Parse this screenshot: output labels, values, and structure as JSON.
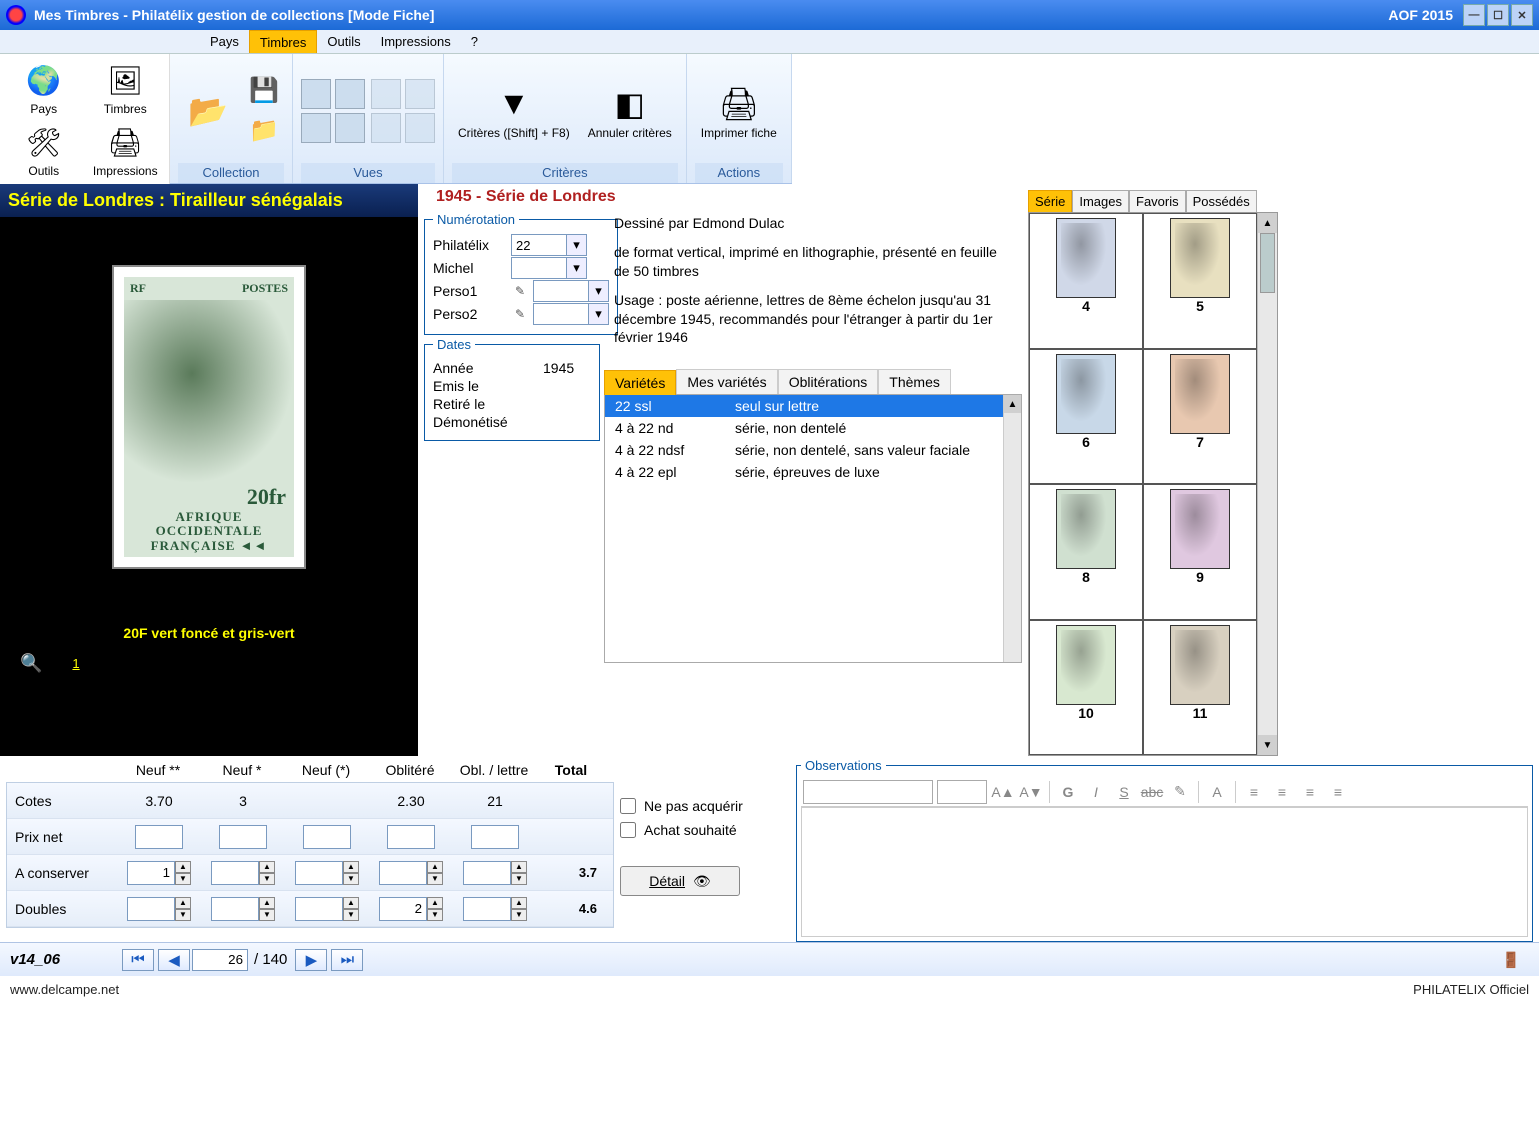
{
  "titlebar": {
    "title": "Mes Timbres - Philatélix gestion de collections [Mode Fiche]",
    "right": "AOF 2015"
  },
  "menustrip": {
    "items": [
      {
        "label": "Pays",
        "active": false
      },
      {
        "label": "Timbres",
        "active": true
      },
      {
        "label": "Outils",
        "active": false
      },
      {
        "label": "Impressions",
        "active": false
      },
      {
        "label": "?",
        "active": false
      }
    ]
  },
  "left_toolbar": [
    {
      "label": "Pays",
      "icon": "🌍"
    },
    {
      "label": "Timbres",
      "icon": "🖼"
    },
    {
      "label": "Outils",
      "icon": "🛠"
    },
    {
      "label": "Impressions",
      "icon": "🖨"
    }
  ],
  "ribbon": {
    "collection": {
      "label": "Collection"
    },
    "vues": {
      "label": "Vues"
    },
    "criteres": {
      "label": "Critères",
      "btn1": "Critères ([Shift] + F8)",
      "btn2": "Annuler critères"
    },
    "actions": {
      "label": "Actions",
      "btn1": "Imprimer fiche"
    }
  },
  "stamp": {
    "panel_title": "Série de Londres : Tirailleur sénégalais",
    "top_left": "RF",
    "top_right": "POSTES",
    "denom": "20fr",
    "country": "AFRIQUE OCCIDENTALE FRANÇAISE ◄◄",
    "caption": "20F vert foncé et gris-vert",
    "page": "1"
  },
  "series_title": "1945 - Série de Londres",
  "numerotation": {
    "legend": "Numérotation",
    "philatelix_label": "Philatélix",
    "philatelix_value": "22",
    "michel_label": "Michel",
    "michel_value": "",
    "perso1_label": "Perso1",
    "perso1_value": "",
    "perso2_label": "Perso2",
    "perso2_value": ""
  },
  "dates": {
    "legend": "Dates",
    "annee_label": "Année",
    "annee_value": "1945",
    "emis_label": "Emis le",
    "emis_value": "",
    "retire_label": "Retiré le",
    "retire_value": "",
    "demon_label": "Démonétisé",
    "demon_value": ""
  },
  "description": {
    "p1": "Dessiné par Edmond Dulac",
    "p2": "de format vertical, imprimé en lithographie, présenté en feuille de 50 timbres",
    "p3": "Usage : poste aérienne, lettres de 8ème échelon jusqu'au 31 décembre 1945, recommandés pour l'étranger à partir du 1er février 1946"
  },
  "var_tabs": [
    {
      "label": "Variétés",
      "active": true
    },
    {
      "label": "Mes variétés",
      "active": false
    },
    {
      "label": "Oblitérations",
      "active": false
    },
    {
      "label": "Thèmes",
      "active": false
    }
  ],
  "varieties": [
    {
      "code": "22 ssl",
      "desc": "seul sur lettre",
      "selected": true
    },
    {
      "code": "4 à 22 nd",
      "desc": "série, non dentelé",
      "selected": false
    },
    {
      "code": "4 à 22 ndsf",
      "desc": "série, non dentelé, sans valeur faciale",
      "selected": false
    },
    {
      "code": "4 à 22 epl",
      "desc": "série, épreuves de luxe",
      "selected": false
    }
  ],
  "right_tabs": [
    {
      "label": "Série",
      "active": true
    },
    {
      "label": "Images",
      "active": false
    },
    {
      "label": "Favoris",
      "active": false
    },
    {
      "label": "Possédés",
      "active": false
    }
  ],
  "thumbs": [
    {
      "num": "4"
    },
    {
      "num": "5"
    },
    {
      "num": "6"
    },
    {
      "num": "7"
    },
    {
      "num": "8"
    },
    {
      "num": "9"
    },
    {
      "num": "10"
    },
    {
      "num": "11"
    }
  ],
  "price": {
    "headers": [
      "",
      "Neuf **",
      "Neuf *",
      "Neuf (*)",
      "Oblitéré",
      "Obl. / lettre",
      "Total"
    ],
    "rows": [
      {
        "label": "Cotes",
        "cells": [
          "3.70",
          "3",
          "",
          "2.30",
          "21"
        ],
        "total": ""
      },
      {
        "label": "Prix net",
        "cells": [
          "",
          "",
          "",
          "",
          ""
        ],
        "total": ""
      },
      {
        "label": "A conserver",
        "cells": [
          "1",
          "",
          "",
          "",
          ""
        ],
        "total": "3.7",
        "spinner": true
      },
      {
        "label": "Doubles",
        "cells": [
          "",
          "",
          "",
          "2",
          ""
        ],
        "total": "4.6",
        "spinner": true
      }
    ]
  },
  "acquire": {
    "no_acquire": "Ne pas acquérir",
    "wish": "Achat souhaité",
    "detail_btn": "Détail"
  },
  "observations": {
    "legend": "Observations"
  },
  "navbar": {
    "version": "v14_06",
    "pos": "26",
    "total": "140"
  },
  "footer": {
    "left": "www.delcampe.net",
    "right": "PHILATELIX Officiel"
  }
}
